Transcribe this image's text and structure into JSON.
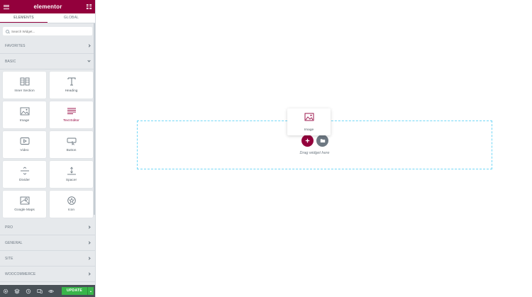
{
  "app": {
    "logo": "elementor"
  },
  "tabs": [
    {
      "label": "ELEMENTS",
      "active": true
    },
    {
      "label": "GLOBAL",
      "active": false
    }
  ],
  "search": {
    "placeholder": "Search Widget..."
  },
  "categories": {
    "favorites": "FAVORITES",
    "basic": "BASIC",
    "pro": "PRO",
    "general": "GENERAL",
    "site": "SITE",
    "woocommerce": "WOOCOMMERCE"
  },
  "widgets": [
    {
      "label": "Inner Section",
      "icon": "columns-icon"
    },
    {
      "label": "Heading",
      "icon": "heading-icon"
    },
    {
      "label": "Image",
      "icon": "image-icon"
    },
    {
      "label": "Text Editor",
      "icon": "text-editor-icon"
    },
    {
      "label": "Video",
      "icon": "video-icon"
    },
    {
      "label": "Button",
      "icon": "button-icon"
    },
    {
      "label": "Divider",
      "icon": "divider-icon"
    },
    {
      "label": "Spacer",
      "icon": "spacer-icon"
    },
    {
      "label": "Google Maps",
      "icon": "map-icon"
    },
    {
      "label": "Icon",
      "icon": "star-icon"
    }
  ],
  "footer": {
    "update_label": "UPDATE"
  },
  "canvas": {
    "drop_text": "Drag widget here",
    "dragging_widget": "Image"
  },
  "colors": {
    "brand": "#93003c",
    "update": "#39b54a",
    "dropzone_border": "#71d7f7"
  }
}
